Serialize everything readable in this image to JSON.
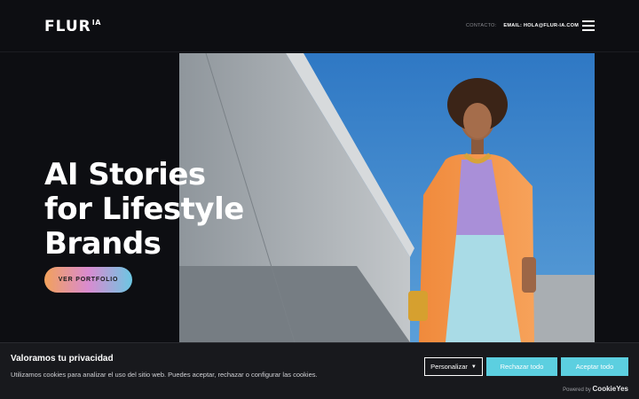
{
  "header": {
    "logo_text": "FLUR",
    "logo_sup": "IA",
    "contact_label": "CONTACTO:",
    "contact_email": "EMAIL: HOLA@FLUR-IA.COM",
    "menu_icon": "hamburger-icon"
  },
  "hero": {
    "headline_lines": [
      "AI Stories",
      "for Lifestyle",
      "Brands"
    ],
    "cta_label": "VER PORTFOLIO",
    "image_description": "fashion-model-photo"
  },
  "cookie_banner": {
    "title": "Valoramos tu privacidad",
    "text": "Utilizamos cookies para analizar el uso del sitio web. Puedes aceptar, rechazar o configurar las cookies.",
    "customize_label": "Personalizar",
    "reject_label": "Rechazar todo",
    "accept_label": "Aceptar todo",
    "powered_label": "Powered by",
    "powered_brand": "CookieYes"
  },
  "colors": {
    "background": "#0d0e12",
    "accent_button": "#5ccfe0",
    "cta_gradient_start": "#f2a15b",
    "cta_gradient_mid": "#d98bd0",
    "cta_gradient_end": "#6cc7e3"
  }
}
